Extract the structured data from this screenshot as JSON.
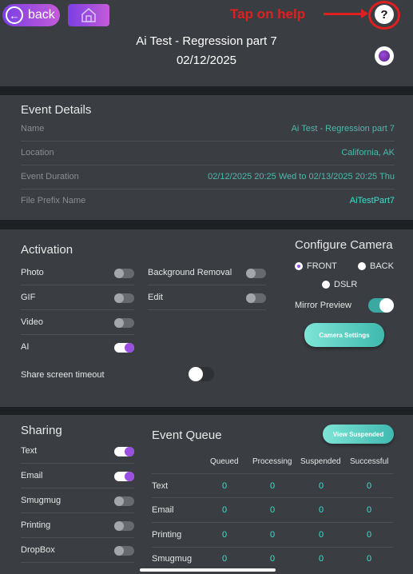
{
  "header": {
    "back_label": "back",
    "annotation": "Tap on help",
    "help_label": "?",
    "title": "Ai Test - Regression part 7",
    "date": "02/12/2025"
  },
  "event_details": {
    "heading": "Event Details",
    "rows": [
      {
        "label": "Name",
        "value": "Ai Test - Regression part 7"
      },
      {
        "label": "Location",
        "value": "California, AK"
      },
      {
        "label": "Event Duration",
        "value": "02/12/2025 20:25 Wed to 02/13/2025 20:25 Thu"
      },
      {
        "label": "File Prefix Name",
        "value": "AiTestPart7"
      }
    ]
  },
  "activation": {
    "heading": "Activation",
    "left": [
      {
        "label": "Photo",
        "on": false
      },
      {
        "label": "GIF",
        "on": false
      },
      {
        "label": "Video",
        "on": false
      },
      {
        "label": "AI",
        "on": true
      }
    ],
    "right": [
      {
        "label": "Background Removal",
        "on": false
      },
      {
        "label": "Edit",
        "on": false
      }
    ],
    "share_timeout_label": "Share screen timeout",
    "share_timeout_on": false
  },
  "camera": {
    "heading": "Configure Camera",
    "options": [
      "FRONT",
      "BACK",
      "DSLR"
    ],
    "selected": "FRONT",
    "mirror_label": "Mirror Preview",
    "mirror_on": true,
    "settings_button": "Camera Settings"
  },
  "sharing": {
    "heading": "Sharing",
    "items": [
      {
        "label": "Text",
        "on": true
      },
      {
        "label": "Email",
        "on": true
      },
      {
        "label": "Smugmug",
        "on": false
      },
      {
        "label": "Printing",
        "on": false
      },
      {
        "label": "DropBox",
        "on": false
      }
    ]
  },
  "queue": {
    "heading": "Event Queue",
    "view_button": "View Suspended",
    "columns": [
      "Queued",
      "Processing",
      "Suspended",
      "Successful"
    ],
    "rows": [
      {
        "label": "Text",
        "values": [
          "0",
          "0",
          "0",
          "0"
        ]
      },
      {
        "label": "Email",
        "values": [
          "0",
          "0",
          "0",
          "0"
        ]
      },
      {
        "label": "Printing",
        "values": [
          "0",
          "0",
          "0",
          "0"
        ]
      },
      {
        "label": "Smugmug",
        "values": [
          "0",
          "0",
          "0",
          "0"
        ]
      }
    ]
  },
  "colors": {
    "accent_purple": "#9a4fe0",
    "teal": "#3ee0d0",
    "annotation_red": "#e02020"
  }
}
